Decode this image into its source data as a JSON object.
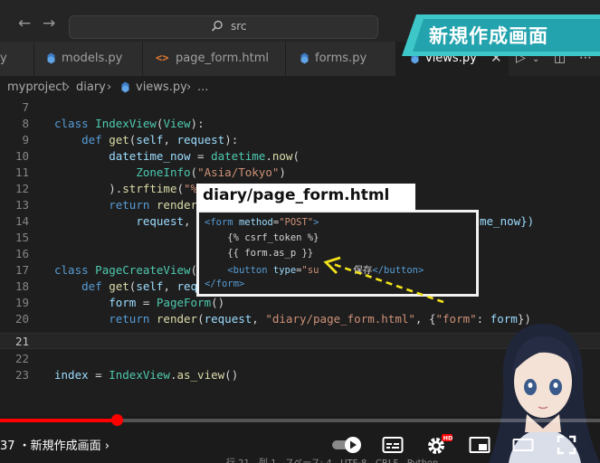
{
  "titlebar": {
    "search_text": "src",
    "banner_text": "新規作成画面"
  },
  "tabs": [
    {
      "label": "y",
      "icon": "python-icon",
      "active": false
    },
    {
      "label": "models.py",
      "icon": "python-icon",
      "active": false
    },
    {
      "label": "page_form.html",
      "icon": "html-icon",
      "active": false
    },
    {
      "label": "forms.py",
      "icon": "python-icon",
      "active": false
    },
    {
      "label": "views.py",
      "icon": "python-icon",
      "active": true
    }
  ],
  "breadcrumb": {
    "items": [
      "myproject",
      "diary",
      "views.py",
      "..."
    ]
  },
  "editor": {
    "current_line": 21,
    "lines": [
      {
        "n": "7",
        "code": ""
      },
      {
        "n": "8",
        "code": "class IndexView(View):"
      },
      {
        "n": "9",
        "code": "    def get(self, request):"
      },
      {
        "n": "10",
        "code": "        datetime_now = datetime.now("
      },
      {
        "n": "11",
        "code": "            ZoneInfo(\"Asia/Tokyo\")"
      },
      {
        "n": "12",
        "code": "        ).strftime(\"%"
      },
      {
        "n": "13",
        "code": "        return render"
      },
      {
        "n": "14",
        "code": "            request, "
      },
      {
        "n": "15",
        "code": ""
      },
      {
        "n": "16",
        "code": ""
      },
      {
        "n": "17",
        "code": "class PageCreateView("
      },
      {
        "n": "18",
        "code": "    def get(self, requ"
      },
      {
        "n": "19",
        "code": "        form = PageForm()"
      },
      {
        "n": "20",
        "code": "        return render(request, \"diary/page_form.html\", {\"form\": form})"
      },
      {
        "n": "21",
        "code": ""
      },
      {
        "n": "22",
        "code": ""
      },
      {
        "n": "23",
        "code": "index = IndexView.as_view()"
      }
    ],
    "line14_tail": "me_now})"
  },
  "overlay": {
    "title": "diary/page_form.html",
    "lines": [
      "<form method=\"POST\">",
      "    {% csrf_token %}",
      "    {{ form.as_p }}",
      "    <button type=\"su      保存</button>",
      "</form>"
    ]
  },
  "player": {
    "progress_fraction": 0.196,
    "chapter": "37 ・新規作成画面 ›",
    "status_bar": "行 21、列 1   スペース: 4   UTF-8   CRLF   Python"
  },
  "colors": {
    "accent_red": "#ff0000",
    "banner": "#3ec7c9",
    "keyword": "#569cd6",
    "class_name": "#4ec9b0",
    "string": "#ce9178"
  }
}
